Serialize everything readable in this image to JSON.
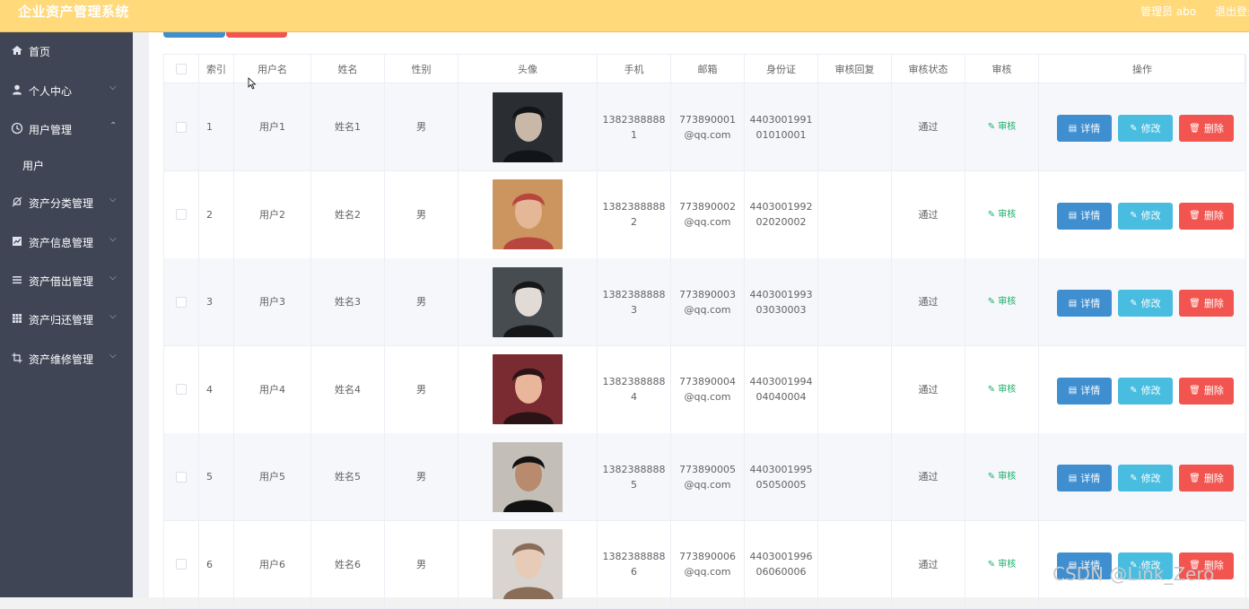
{
  "header": {
    "title": "企业资产管理系统",
    "admin": "管理员 abo",
    "logout": "退出登录"
  },
  "colors": {
    "header": "#ffd97a",
    "sidebar": "#3f4555",
    "detail": "#3e8ed0",
    "edit": "#48bde0",
    "delete": "#f2554f",
    "audit": "#18b066"
  },
  "sidebar": {
    "items": [
      {
        "label": "首页",
        "icon": "home-icon"
      },
      {
        "label": "个人中心",
        "icon": "user-icon"
      },
      {
        "label": "用户管理",
        "icon": "clock-icon"
      },
      {
        "label": "用户",
        "icon": ""
      },
      {
        "label": "资产分类管理",
        "icon": "bell-off-icon"
      },
      {
        "label": "资产信息管理",
        "icon": "chart-icon"
      },
      {
        "label": "资产借出管理",
        "icon": "list-icon"
      },
      {
        "label": "资产归还管理",
        "icon": "grid-icon"
      },
      {
        "label": "资产维修管理",
        "icon": "crop-icon"
      }
    ]
  },
  "table": {
    "columns": [
      "",
      "索引",
      "用户名",
      "姓名",
      "性别",
      "头像",
      "手机",
      "邮箱",
      "身份证",
      "审核回复",
      "审核状态",
      "审核",
      "操作"
    ],
    "audit_label": "审核",
    "buttons": {
      "detail": "详情",
      "edit": "修改",
      "delete": "删除"
    },
    "rows": [
      {
        "index": "1",
        "username": "用户1",
        "name": "姓名1",
        "gender": "男",
        "phone": [
          "1382388888",
          "1"
        ],
        "email": [
          "773890001",
          "@qq.com"
        ],
        "id_card": [
          "4403001991",
          "01010001"
        ],
        "reply": "",
        "status": "通过"
      },
      {
        "index": "2",
        "username": "用户2",
        "name": "姓名2",
        "gender": "男",
        "phone": [
          "1382388888",
          "2"
        ],
        "email": [
          "773890002",
          "@qq.com"
        ],
        "id_card": [
          "4403001992",
          "02020002"
        ],
        "reply": "",
        "status": "通过"
      },
      {
        "index": "3",
        "username": "用户3",
        "name": "姓名3",
        "gender": "男",
        "phone": [
          "1382388888",
          "3"
        ],
        "email": [
          "773890003",
          "@qq.com"
        ],
        "id_card": [
          "4403001993",
          "03030003"
        ],
        "reply": "",
        "status": "通过"
      },
      {
        "index": "4",
        "username": "用户4",
        "name": "姓名4",
        "gender": "男",
        "phone": [
          "1382388888",
          "4"
        ],
        "email": [
          "773890004",
          "@qq.com"
        ],
        "id_card": [
          "4403001994",
          "04040004"
        ],
        "reply": "",
        "status": "通过"
      },
      {
        "index": "5",
        "username": "用户5",
        "name": "姓名5",
        "gender": "男",
        "phone": [
          "1382388888",
          "5"
        ],
        "email": [
          "773890005",
          "@qq.com"
        ],
        "id_card": [
          "4403001995",
          "05050005"
        ],
        "reply": "",
        "status": "通过"
      },
      {
        "index": "6",
        "username": "用户6",
        "name": "姓名6",
        "gender": "男",
        "phone": [
          "1382388888",
          "6"
        ],
        "email": [
          "773890006",
          "@qq.com"
        ],
        "id_card": [
          "4403001996",
          "06060006"
        ],
        "reply": "",
        "status": "通过"
      }
    ]
  },
  "watermark": "CSDN @Link_Zero"
}
